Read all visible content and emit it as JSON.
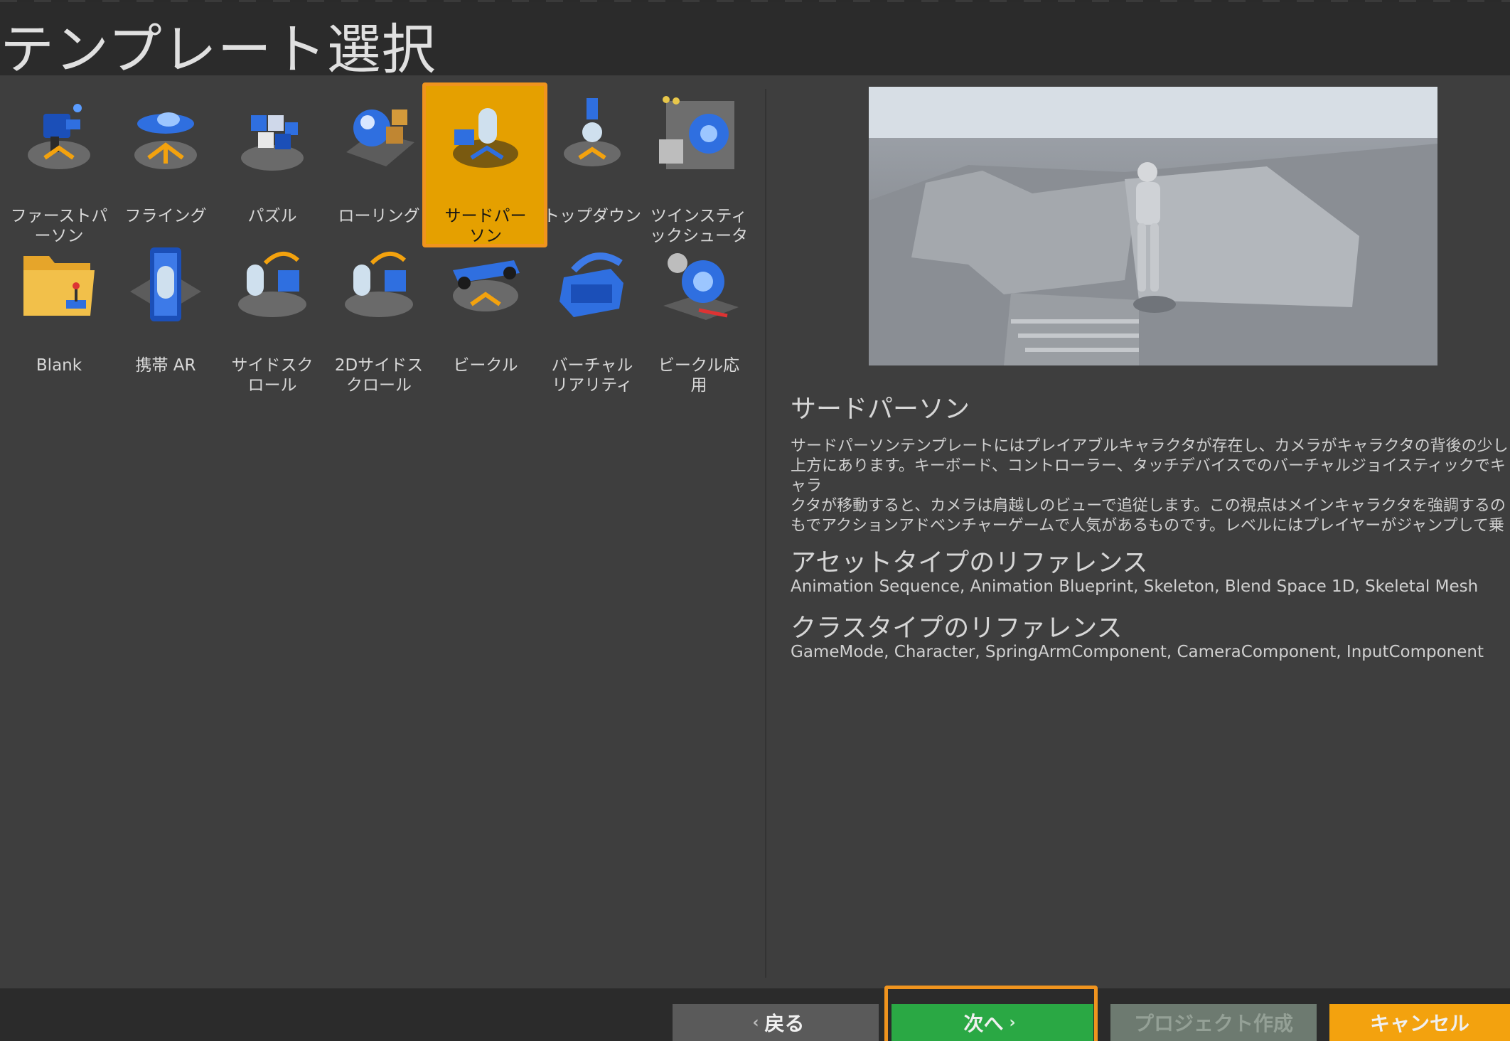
{
  "header": {
    "title": "テンプレート選択"
  },
  "templates": [
    {
      "label": "ファーストパ\nーソン",
      "icon": "first-person-icon"
    },
    {
      "label": "フライング",
      "icon": "flying-icon"
    },
    {
      "label": "パズル",
      "icon": "puzzle-icon"
    },
    {
      "label": "ローリング",
      "icon": "rolling-icon"
    },
    {
      "label": "サードパー\nソン",
      "icon": "third-person-icon",
      "selected": true
    },
    {
      "label": "トップダウン",
      "icon": "top-down-icon"
    },
    {
      "label": "ツインスティ\nックシュータ",
      "icon": "twin-stick-shooter-icon"
    },
    {
      "label": "Blank",
      "icon": "blank-folder-icon"
    },
    {
      "label": "携帯 AR",
      "icon": "handheld-ar-icon"
    },
    {
      "label": "サイドスク\nロール",
      "icon": "side-scroller-icon"
    },
    {
      "label": "2Dサイドス\nクロール",
      "icon": "2d-side-scroller-icon"
    },
    {
      "label": "ビークル",
      "icon": "vehicle-icon"
    },
    {
      "label": "バーチャル\nリアリティ",
      "icon": "virtual-reality-icon"
    },
    {
      "label": "ビークル応\n用",
      "icon": "vehicle-advanced-icon"
    }
  ],
  "details": {
    "title": "サードパーソン",
    "description": "サードパーソンテンプレートにはプレイアブルキャラクタが存在し、カメラがキャラクタの背後の少し\n上方にあります。キーボード、コントローラー、タッチデバイスでのバーチャルジョイスティックでキャラ\nクタが移動すると、カメラは肩越しのビューで追従します。この視点はメインキャラクタを強調するの\nもでアクションアドベンチャーゲームで人気があるものです。レベルにはプレイヤーがジャンプして乗\nることができるオブジェクトが置かれています。",
    "asset_refs_title": "アセットタイプのリファレンス",
    "asset_refs": "Animation Sequence, Animation Blueprint, Skeleton, Blend Space 1D, Skeletal Mesh",
    "class_refs_title": "クラスタイプのリファレンス",
    "class_refs": "GameMode, Character, SpringArmComponent, CameraComponent, InputComponent"
  },
  "footer": {
    "back": "戻る",
    "next": "次へ",
    "create": "プロジェクト作成",
    "cancel": "キャンセル"
  },
  "colors": {
    "accent": "#f0941e",
    "selected": "#e5a000",
    "next": "#2aa844",
    "cancel": "#f3a20e"
  }
}
